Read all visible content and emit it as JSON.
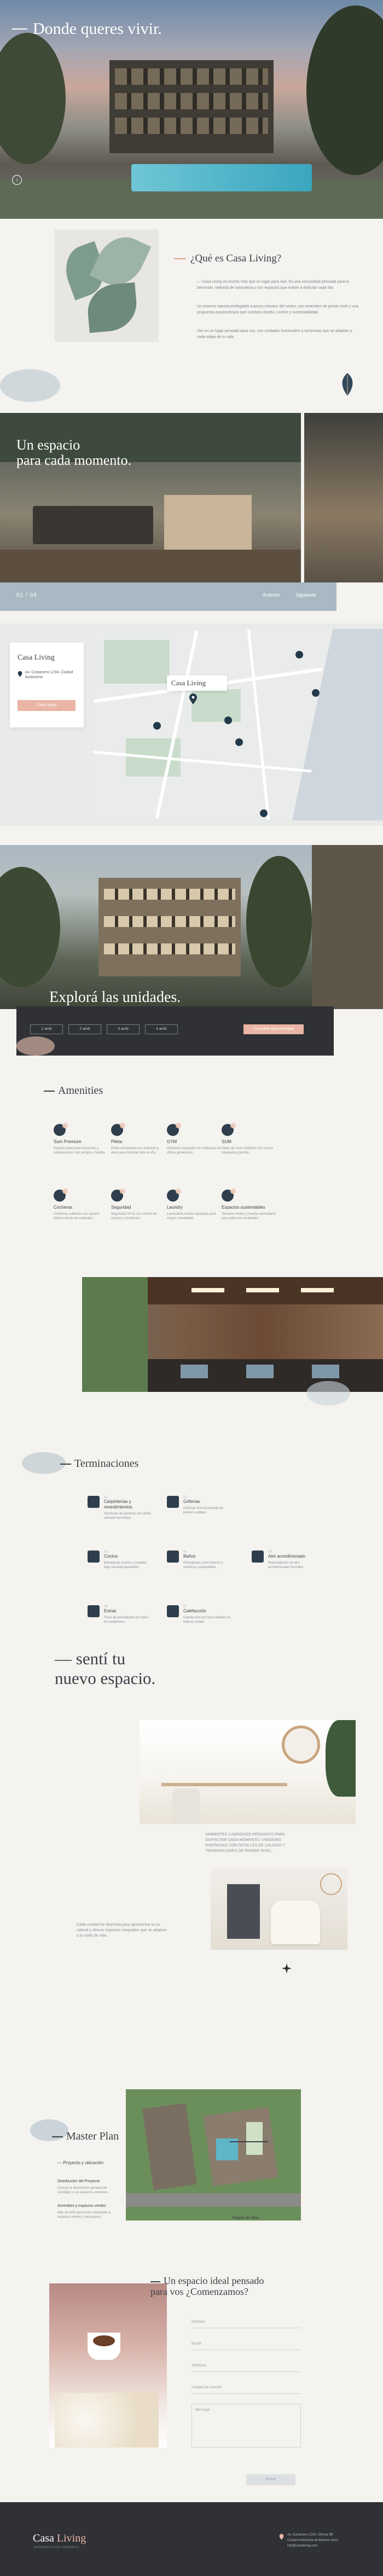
{
  "hero": {
    "title": "Donde queres vivir.",
    "arrow": "↓"
  },
  "que_es": {
    "title": "¿Qué es Casa Living?",
    "paragraphs": [
      "— Casa Living es mucho más que un lugar para vivir. Es una comunidad pensada para tu bienestar, rodeada de naturaleza y con espacios que invitan a disfrutar cada día.",
      "Un entorno natural privilegiado a pocos minutos del centro, con amenities de primer nivel y una propuesta arquitectónica que combina diseño, confort y sustentabilidad.",
      "Viví en un lugar pensado para vos, con unidades funcionales y luminosas que se adaptan a cada etapa de tu vida."
    ]
  },
  "espacio": {
    "title_line1": "Un espacio",
    "title_line2": "para cada momento.",
    "counter": "01 / 04",
    "prev": "Anterior",
    "next": "Siguiente"
  },
  "map": {
    "logo": "Casa Living",
    "address": "Av. Costanera 1234, Ciudad Autónoma",
    "button": "Cómo llegar",
    "label": "Casa Living"
  },
  "unidades": {
    "title": "Explorá las unidades.",
    "tabs": [
      "1 amb",
      "2 amb",
      "3 amb",
      "4 amb"
    ],
    "cta": "Consultar disponibilidad"
  },
  "amenities": {
    "title": "Amenities",
    "items": [
      {
        "name": "Sum Premium",
        "desc": "Espacio ideal para reuniones y celebraciones con amigos y familia."
      },
      {
        "name": "Pileta",
        "desc": "Pileta climatizada con solarium y deck para disfrutar todo el año."
      },
      {
        "name": "GYM",
        "desc": "Gimnasio equipado con máquinas de última generación."
      },
      {
        "name": "SUM",
        "desc": "Salón de usos múltiples con cocina integrada y parrilla."
      },
      {
        "name": "Cocheras",
        "desc": "Cocheras cubiertas con acceso directo desde las unidades."
      },
      {
        "name": "Seguridad",
        "desc": "Seguridad 24 hs con control de acceso y monitoreo."
      },
      {
        "name": "Laundry",
        "desc": "Lavandería común equipada para mayor comodidad."
      },
      {
        "name": "Espacios sustentables",
        "desc": "Terrazas verdes y huerta comunitaria para todos los residentes."
      }
    ]
  },
  "terminaciones": {
    "title": "Terminaciones",
    "items": [
      {
        "num": "01",
        "name": "Carpinterías y revestimientos",
        "desc": "Aberturas de aluminio con doble vidriado hermético."
      },
      {
        "num": "02",
        "name": "Griferías",
        "desc": "Griferías monocomando de primera calidad."
      },
      {
        "num": "03",
        "name": "Cocina",
        "desc": "Mesada de cuarzo y muebles bajo mesada laqueados."
      },
      {
        "num": "04",
        "name": "Baños",
        "desc": "Porcelanato símil mármol y vanitorys suspendidos."
      },
      {
        "num": "05",
        "name": "Aire acondicionado",
        "desc": "Preinstalación de aire acondicionado frío/calor."
      },
      {
        "num": "06",
        "name": "Extras",
        "desc": "Pisos de porcelanato en todos los ambientes."
      },
      {
        "num": "07",
        "name": "Calefacción",
        "desc": "Calefacción por losa radiante en toda la unidad."
      }
    ]
  },
  "senti": {
    "title_line1": "— sentí tu",
    "title_line2": "nuevo espacio.",
    "text1": "AMBIENTES LUMINOSOS PENSADOS PARA DISFRUTAR CADA MOMENTO. UNIDADES DISEÑADAS CON DETALLES DE CALIDAD Y TERMINACIONES DE PRIMER NIVEL.",
    "text2": "Cada unidad fue diseñada para aprovechar la luz natural y ofrecer espacios integrados que se adaptan a tu estilo de vida."
  },
  "master": {
    "title": "Master Plan",
    "links": [
      "— Proyecto y ubicación",
      "Distribución del Proyecto",
      "Amenities y espacios verdes",
      "Etapas de obra"
    ],
    "descs": [
      "Conocé la distribución general del complejo y sus espacios comunes.",
      "Más de 60% del terreno destinado a espacios verdes y recreativos."
    ]
  },
  "contact": {
    "title_line1": "Un espacio ideal pensado",
    "title_line2": "para vos ¿Comenzamos?",
    "fields": [
      "Nombre",
      "Email",
      "Teléfono",
      "Unidad de interés",
      "Mensaje"
    ],
    "send": "Enviar"
  },
  "footer": {
    "logo_a": "Casa ",
    "logo_b": "Living",
    "tagline": "DESARROLLOS URBANOS",
    "info_line1": "Av. Costanera 1234, Oficina 3B",
    "info_line2": "Ciudad Autónoma de Buenos Aires",
    "info_line3": "info@casaliving.com"
  }
}
